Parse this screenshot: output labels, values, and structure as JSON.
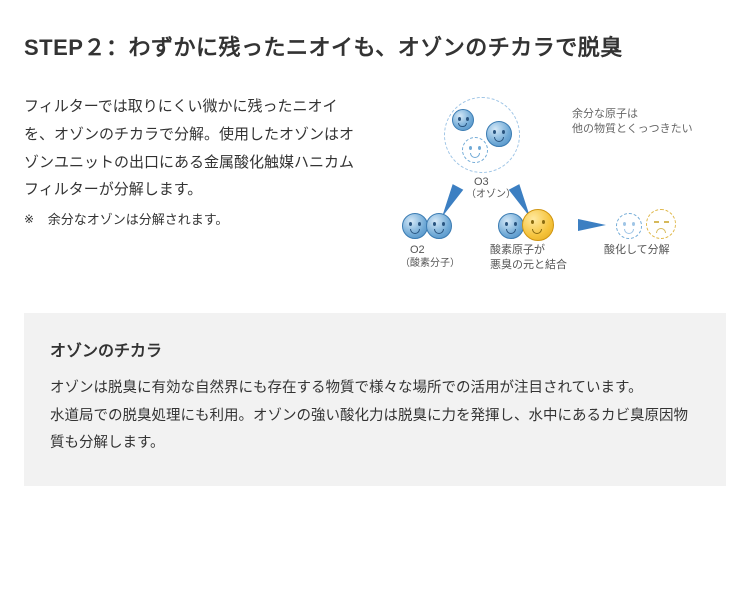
{
  "step": {
    "title": "STEP２：わずかに残ったニオイも、オゾンのチカラで脱臭"
  },
  "main": {
    "paragraph": "フィルターでは取りにくい微かに残ったニオイを、オゾンのチカラで分解。使用したオゾンはオゾンユニットの出口にある金属酸化触媒ハニカムフィルターが分解します。",
    "footnote_mark": "※",
    "footnote": "余分なオゾンは分解されます。"
  },
  "diagram": {
    "note_line1": "余分な原子は",
    "note_line2": "他の物質とくっつきたい",
    "o3": "O3",
    "o3_sub": "（オゾン）",
    "o2": "O2",
    "o2_sub": "（酸素分子）",
    "combine_line1": "酸素原子が",
    "combine_line2": "悪臭の元と結合",
    "oxide": "酸化して分解"
  },
  "callout": {
    "title": "オゾンのチカラ",
    "body": "オゾンは脱臭に有効な自然界にも存在する物質で様々な場所での活用が注目されています。\n水道局での脱臭処理にも利用。オゾンの強い酸化力は脱臭に力を発揮し、水中にあるカビ臭原因物質も分解します。"
  }
}
